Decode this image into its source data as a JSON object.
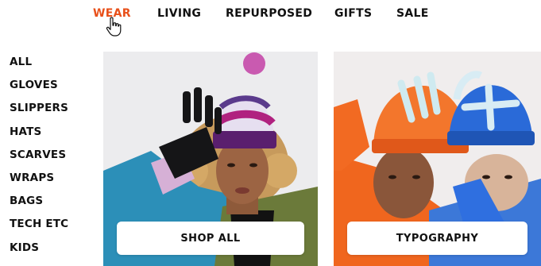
{
  "topnav": [
    {
      "label": "WEAR",
      "active": true
    },
    {
      "label": "LIVING",
      "active": false
    },
    {
      "label": "REPURPOSED",
      "active": false
    },
    {
      "label": "GIFTS",
      "active": false
    },
    {
      "label": "SALE",
      "active": false
    }
  ],
  "sidenav": [
    "ALL",
    "GLOVES",
    "SLIPPERS",
    "HATS",
    "SCARVES",
    "WRAPS",
    "BAGS",
    "TECH ETC",
    "KIDS"
  ],
  "tiles": [
    {
      "button": "SHOP ALL"
    },
    {
      "button": "TYPOGRAPHY"
    }
  ],
  "colors": {
    "accent": "#e8501a",
    "text": "#111111"
  },
  "icons": {
    "cursor": "hand-pointer-icon"
  }
}
